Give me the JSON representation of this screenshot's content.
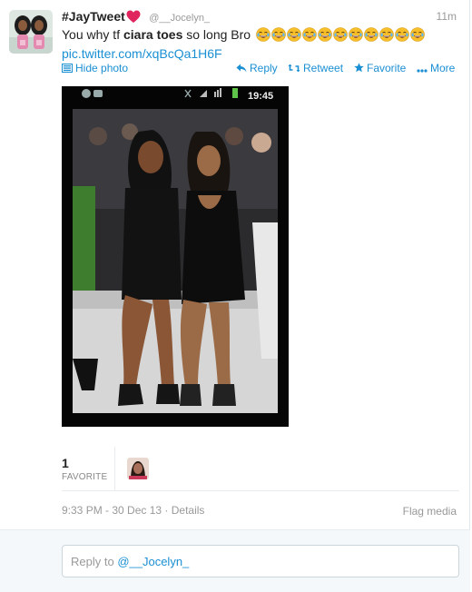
{
  "tweet": {
    "display_name": "#JayTweet",
    "handle": "@__Jocelyn_",
    "time": "11m",
    "text_before": "You why tf ",
    "text_bold": "ciara toes",
    "text_after": " so long Bro",
    "emoji_icon": "face-with-tears-of-joy-emoji",
    "emoji_count": 11,
    "link": "pic.twitter.com/xqBcQa1H6F"
  },
  "actions": {
    "hide_photo": "Hide photo",
    "reply": "Reply",
    "retweet": "Retweet",
    "favorite": "Favorite",
    "more": "More"
  },
  "photo_status_bar": {
    "time": "19:45"
  },
  "stats": {
    "favorites_count": "1",
    "favorites_label": "FAVORITE"
  },
  "meta": {
    "timestamp": "9:33 PM - 30 Dec 13",
    "separator": " · ",
    "details": "Details",
    "flag_media": "Flag media"
  },
  "reply": {
    "prefix": "Reply to ",
    "mention": "@__Jocelyn_"
  },
  "colors": {
    "link": "#1a8fd3",
    "heart": "#e0245e",
    "muted": "#999999"
  }
}
